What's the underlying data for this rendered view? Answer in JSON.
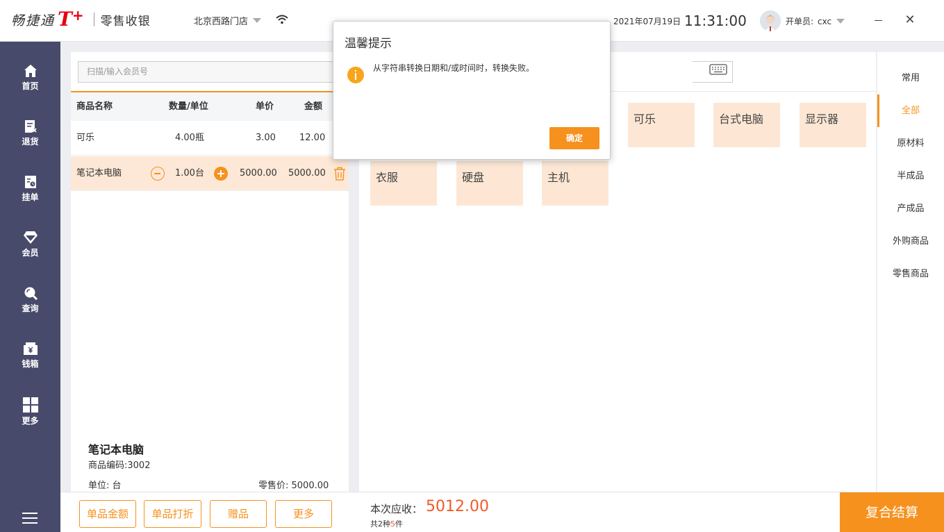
{
  "app": {
    "brand_name": "畅捷通",
    "brand_mark": "T",
    "brand_plus": "+",
    "app_name": "零售收银",
    "store": "北京西路门店",
    "date": "2021年07月19日",
    "time": "11:31:00",
    "operator_label": "开单员:",
    "operator_name": "cxc",
    "close_glyph": "✕"
  },
  "colors": {
    "accent": "#f6911e",
    "sidebar": "#484a6b",
    "amount": "#f05a28",
    "tile": "#fde7d4"
  },
  "sidebar": {
    "items": [
      {
        "label": "首页",
        "icon": "home-icon"
      },
      {
        "label": "退货",
        "icon": "return-icon"
      },
      {
        "label": "挂单",
        "icon": "hold-order-icon"
      },
      {
        "label": "会员",
        "icon": "member-diamond-icon"
      },
      {
        "label": "查询",
        "icon": "search-icon"
      },
      {
        "label": "钱箱",
        "icon": "cash-drawer-icon"
      },
      {
        "label": "更多",
        "icon": "grid-icon"
      }
    ]
  },
  "cart": {
    "member_placeholder": "扫描/输入会员号",
    "columns": {
      "name": "商品名称",
      "qty": "数量/单位",
      "price": "单价",
      "amount": "金额"
    },
    "rows": [
      {
        "name": "可乐",
        "qty": "4.00瓶",
        "price": "3.00",
        "amount": "12.00"
      },
      {
        "name": "笔记本电脑",
        "qty": "1.00台",
        "price": "5000.00",
        "amount": "5000.00"
      }
    ]
  },
  "detail": {
    "name": "笔记本电脑",
    "code": "商品编码:3002",
    "unit": "单位:  台",
    "price": "零售价:  5000.00"
  },
  "products": {
    "tiles": [
      "可乐",
      "台式电脑",
      "显示器",
      "衣服",
      "硬盘",
      "主机"
    ]
  },
  "categories": [
    "常用",
    "全部",
    "原材料",
    "半成品",
    "产成品",
    "外购商品",
    "零售商品"
  ],
  "bottom": {
    "buttons": [
      "单品金额",
      "单品打折",
      "赠品",
      "更多"
    ],
    "due_label": "本次应收：",
    "due_amount": "5012.00",
    "count_prefix": "共2种",
    "count_pieces": "5",
    "count_suffix": "件",
    "checkout": "复合结算"
  },
  "dialog": {
    "title": "温馨提示",
    "message": "从字符串转换日期和/或时间时，转换失败。",
    "ok": "确定"
  }
}
